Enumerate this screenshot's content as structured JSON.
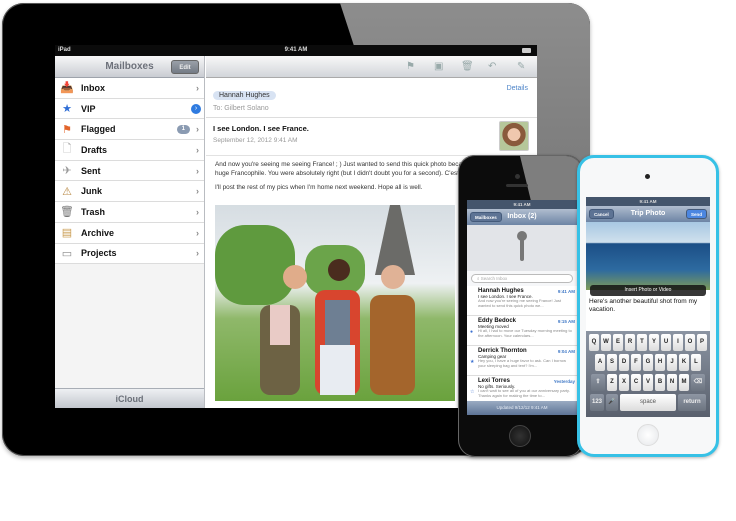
{
  "ipad": {
    "status": {
      "carrier": "iPad",
      "time": "9:41 AM"
    },
    "sidebar": {
      "title": "Mailboxes",
      "edit_label": "Edit",
      "items": [
        {
          "label": "Inbox",
          "icon": "inbox-icon"
        },
        {
          "label": "VIP",
          "icon": "star-icon"
        },
        {
          "label": "Flagged",
          "icon": "flag-icon",
          "badge": "1"
        },
        {
          "label": "Drafts",
          "icon": "document-icon"
        },
        {
          "label": "Sent",
          "icon": "sent-icon"
        },
        {
          "label": "Junk",
          "icon": "junk-icon"
        },
        {
          "label": "Trash",
          "icon": "trash-icon"
        },
        {
          "label": "Archive",
          "icon": "archive-icon"
        },
        {
          "label": "Projects",
          "icon": "folder-icon"
        }
      ],
      "footer": "iCloud"
    },
    "message": {
      "from": "Hannah Hughes",
      "to": "To: Gilbert Solano",
      "details_label": "Details",
      "subject": "I see London. I see France.",
      "date": "September 12, 2012 9:41 AM",
      "body": [
        "And now you're seeing me seeing France! ; ) Just wanted to send this quick photo because I know you're a huge Francophile. You were absolutely right (but I didn't doubt you for a second). C'est très magnifique ici.",
        "I'll post the rest of my pics when I'm home next weekend. Hope all is well."
      ],
      "toolbar_icons": [
        "flag-icon",
        "folder-icon",
        "trash-icon",
        "reply-icon",
        "compose-icon"
      ]
    }
  },
  "iphone": {
    "back_label": "Mailboxes",
    "title": "Inbox (2)",
    "search_placeholder": "Search Inbox",
    "messages": [
      {
        "name": "Hannah Hughes",
        "subject": "I see London. I see France.",
        "preview": "And now you're seeing me seeing France! Just wanted to send this quick photo we...",
        "time": "9:41 AM",
        "mark": ""
      },
      {
        "name": "Eddy Bedock",
        "subject": "Meeting moved",
        "preview": "Hi all, I had to move our Tuesday morning meeting to the afternoon. Your calendars...",
        "time": "9:15 AM",
        "mark": "●"
      },
      {
        "name": "Derrick Thornton",
        "subject": "Camping gear",
        "preview": "Hey you, I have a huge favor to ask. Can I borrow your sleeping bag and tent? I'm...",
        "time": "9:04 AM",
        "mark": "★"
      },
      {
        "name": "Lexi Torres",
        "subject": "No gifts. Seriously.",
        "preview": "I can't wait to see all of you at our anniversary party. Thanks again for making the time to...",
        "time": "Yesterday",
        "mark": "☆"
      }
    ],
    "updated": "Updated 9/12/12 9:41 AM"
  },
  "ipod": {
    "cancel_label": "Cancel",
    "title": "Trip Photo",
    "send_label": "Send",
    "insert_label": "Insert Photo or Video",
    "body_text": "Here's another beautiful shot from my vacation.",
    "keyboard": {
      "row1": [
        "Q",
        "W",
        "E",
        "R",
        "T",
        "Y",
        "U",
        "I",
        "O",
        "P"
      ],
      "row2": [
        "A",
        "S",
        "D",
        "F",
        "G",
        "H",
        "J",
        "K",
        "L"
      ],
      "row3": [
        "Z",
        "X",
        "C",
        "V",
        "B",
        "N",
        "M"
      ],
      "numbers": "123",
      "space": "space",
      "return": "return"
    }
  }
}
